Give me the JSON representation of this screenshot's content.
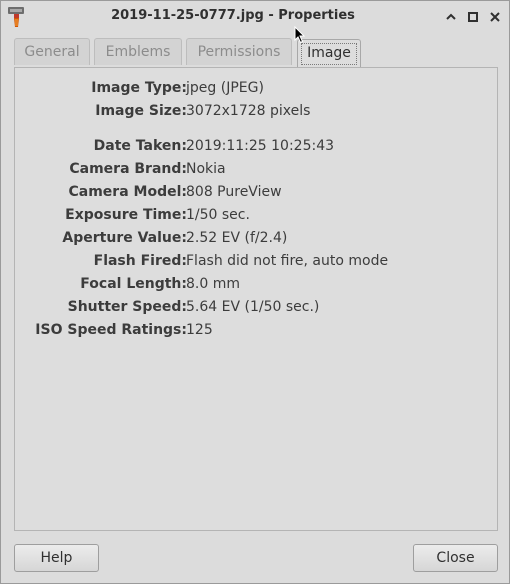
{
  "window": {
    "title": "2019-11-25-0777.jpg - Properties"
  },
  "titlebar_buttons": [
    "minimize-icon",
    "maximize-icon",
    "close-icon"
  ],
  "tabs": [
    {
      "label": "General",
      "active": false
    },
    {
      "label": "Emblems",
      "active": false
    },
    {
      "label": "Permissions",
      "active": false
    },
    {
      "label": "Image",
      "active": true
    }
  ],
  "properties": [
    {
      "label": "Image Type:",
      "value": "jpeg (JPEG)"
    },
    {
      "label": "Image Size:",
      "value": "3072x1728 pixels"
    },
    {
      "label": "Date Taken:",
      "value": "2019:11:25 10:25:43"
    },
    {
      "label": "Camera Brand:",
      "value": "Nokia"
    },
    {
      "label": "Camera Model:",
      "value": "808 PureView"
    },
    {
      "label": "Exposure Time:",
      "value": "1/50 sec."
    },
    {
      "label": "Aperture Value:",
      "value": "2.52 EV (f/2.4)"
    },
    {
      "label": "Flash Fired:",
      "value": "Flash did not fire, auto mode"
    },
    {
      "label": "Focal Length:",
      "value": "8.0 mm"
    },
    {
      "label": "Shutter Speed:",
      "value": "5.64 EV (1/50 sec.)"
    },
    {
      "label": "ISO Speed Ratings:",
      "value": "125"
    }
  ],
  "buttons": {
    "help": "Help",
    "close": "Close"
  }
}
